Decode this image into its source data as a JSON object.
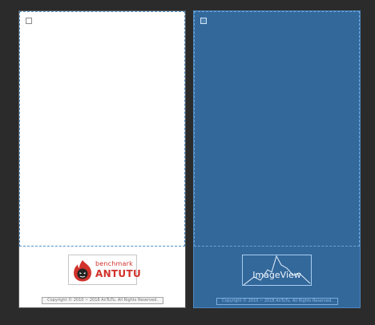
{
  "design": {
    "logo": {
      "small_text": "benchmark",
      "big_text": "ANTUTU",
      "brand_color": "#d0322b"
    },
    "copyright": "Copyright © 2010 ~ 2018 AnTuTu. All Rights Reserved."
  },
  "blueprint": {
    "image_view_label": "ImageView",
    "copyright": "Copyright © 2010 ~ 2018 AnTuTu. All Rights Reserved."
  },
  "colors": {
    "canvas_background": "#2b2b2b",
    "design_background": "#ffffff",
    "blueprint_background": "#33689b",
    "guide_line": "#4f8fca"
  }
}
